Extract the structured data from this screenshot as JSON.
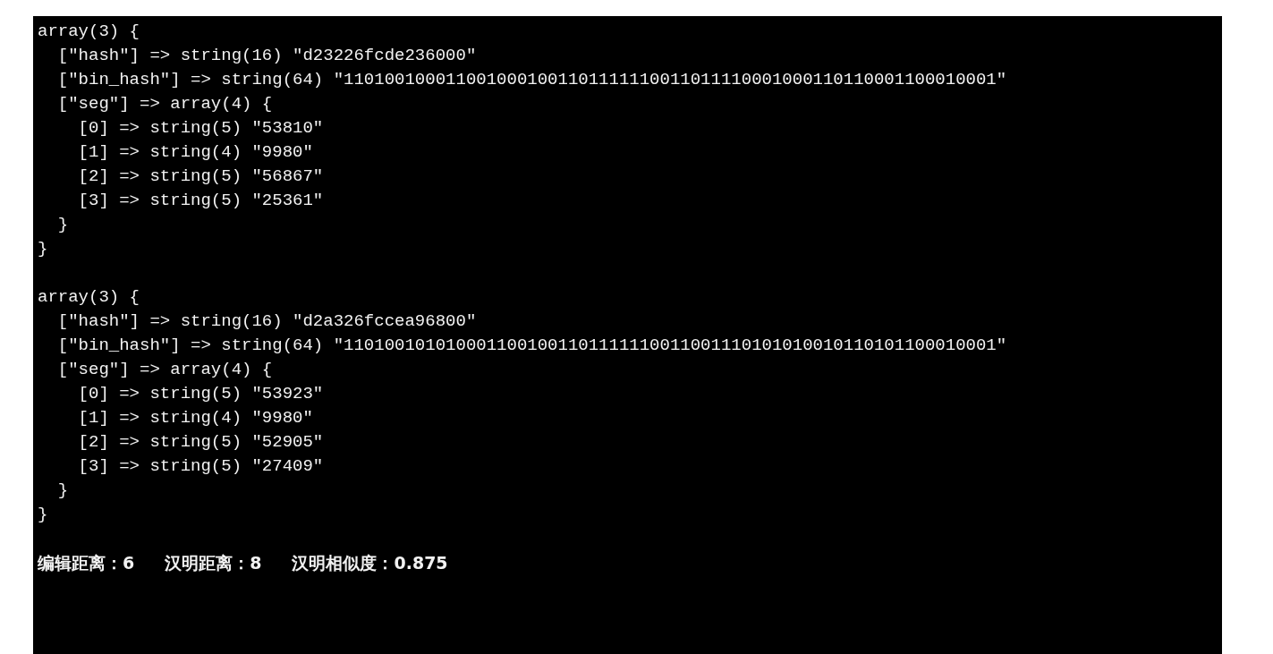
{
  "dumps": [
    {
      "lines": [
        "array(3) {",
        "  [\"hash\"] => string(16) \"d23226fcde236000\"",
        "  [\"bin_hash\"] => string(64) \"1101001000110010001001101111110011011110001000110110001100010001\"",
        "  [\"seg\"] => array(4) {",
        "    [0] => string(5) \"53810\"",
        "    [1] => string(4) \"9980\"",
        "    [2] => string(5) \"56867\"",
        "    [3] => string(5) \"25361\"",
        "  }",
        "}"
      ]
    },
    {
      "lines": [
        "array(3) {",
        "  [\"hash\"] => string(16) \"d2a326fccea96800\"",
        "  [\"bin_hash\"] => string(64) \"1101001010100011001001101111110011001110101010010110101100010001\"",
        "  [\"seg\"] => array(4) {",
        "    [0] => string(5) \"53923\"",
        "    [1] => string(4) \"9980\"",
        "    [2] => string(5) \"52905\"",
        "    [3] => string(5) \"27409\"",
        "  }",
        "}"
      ]
    }
  ],
  "summary": [
    "编辑距离：6",
    "汉明距离：8",
    "汉明相似度：0.875"
  ]
}
